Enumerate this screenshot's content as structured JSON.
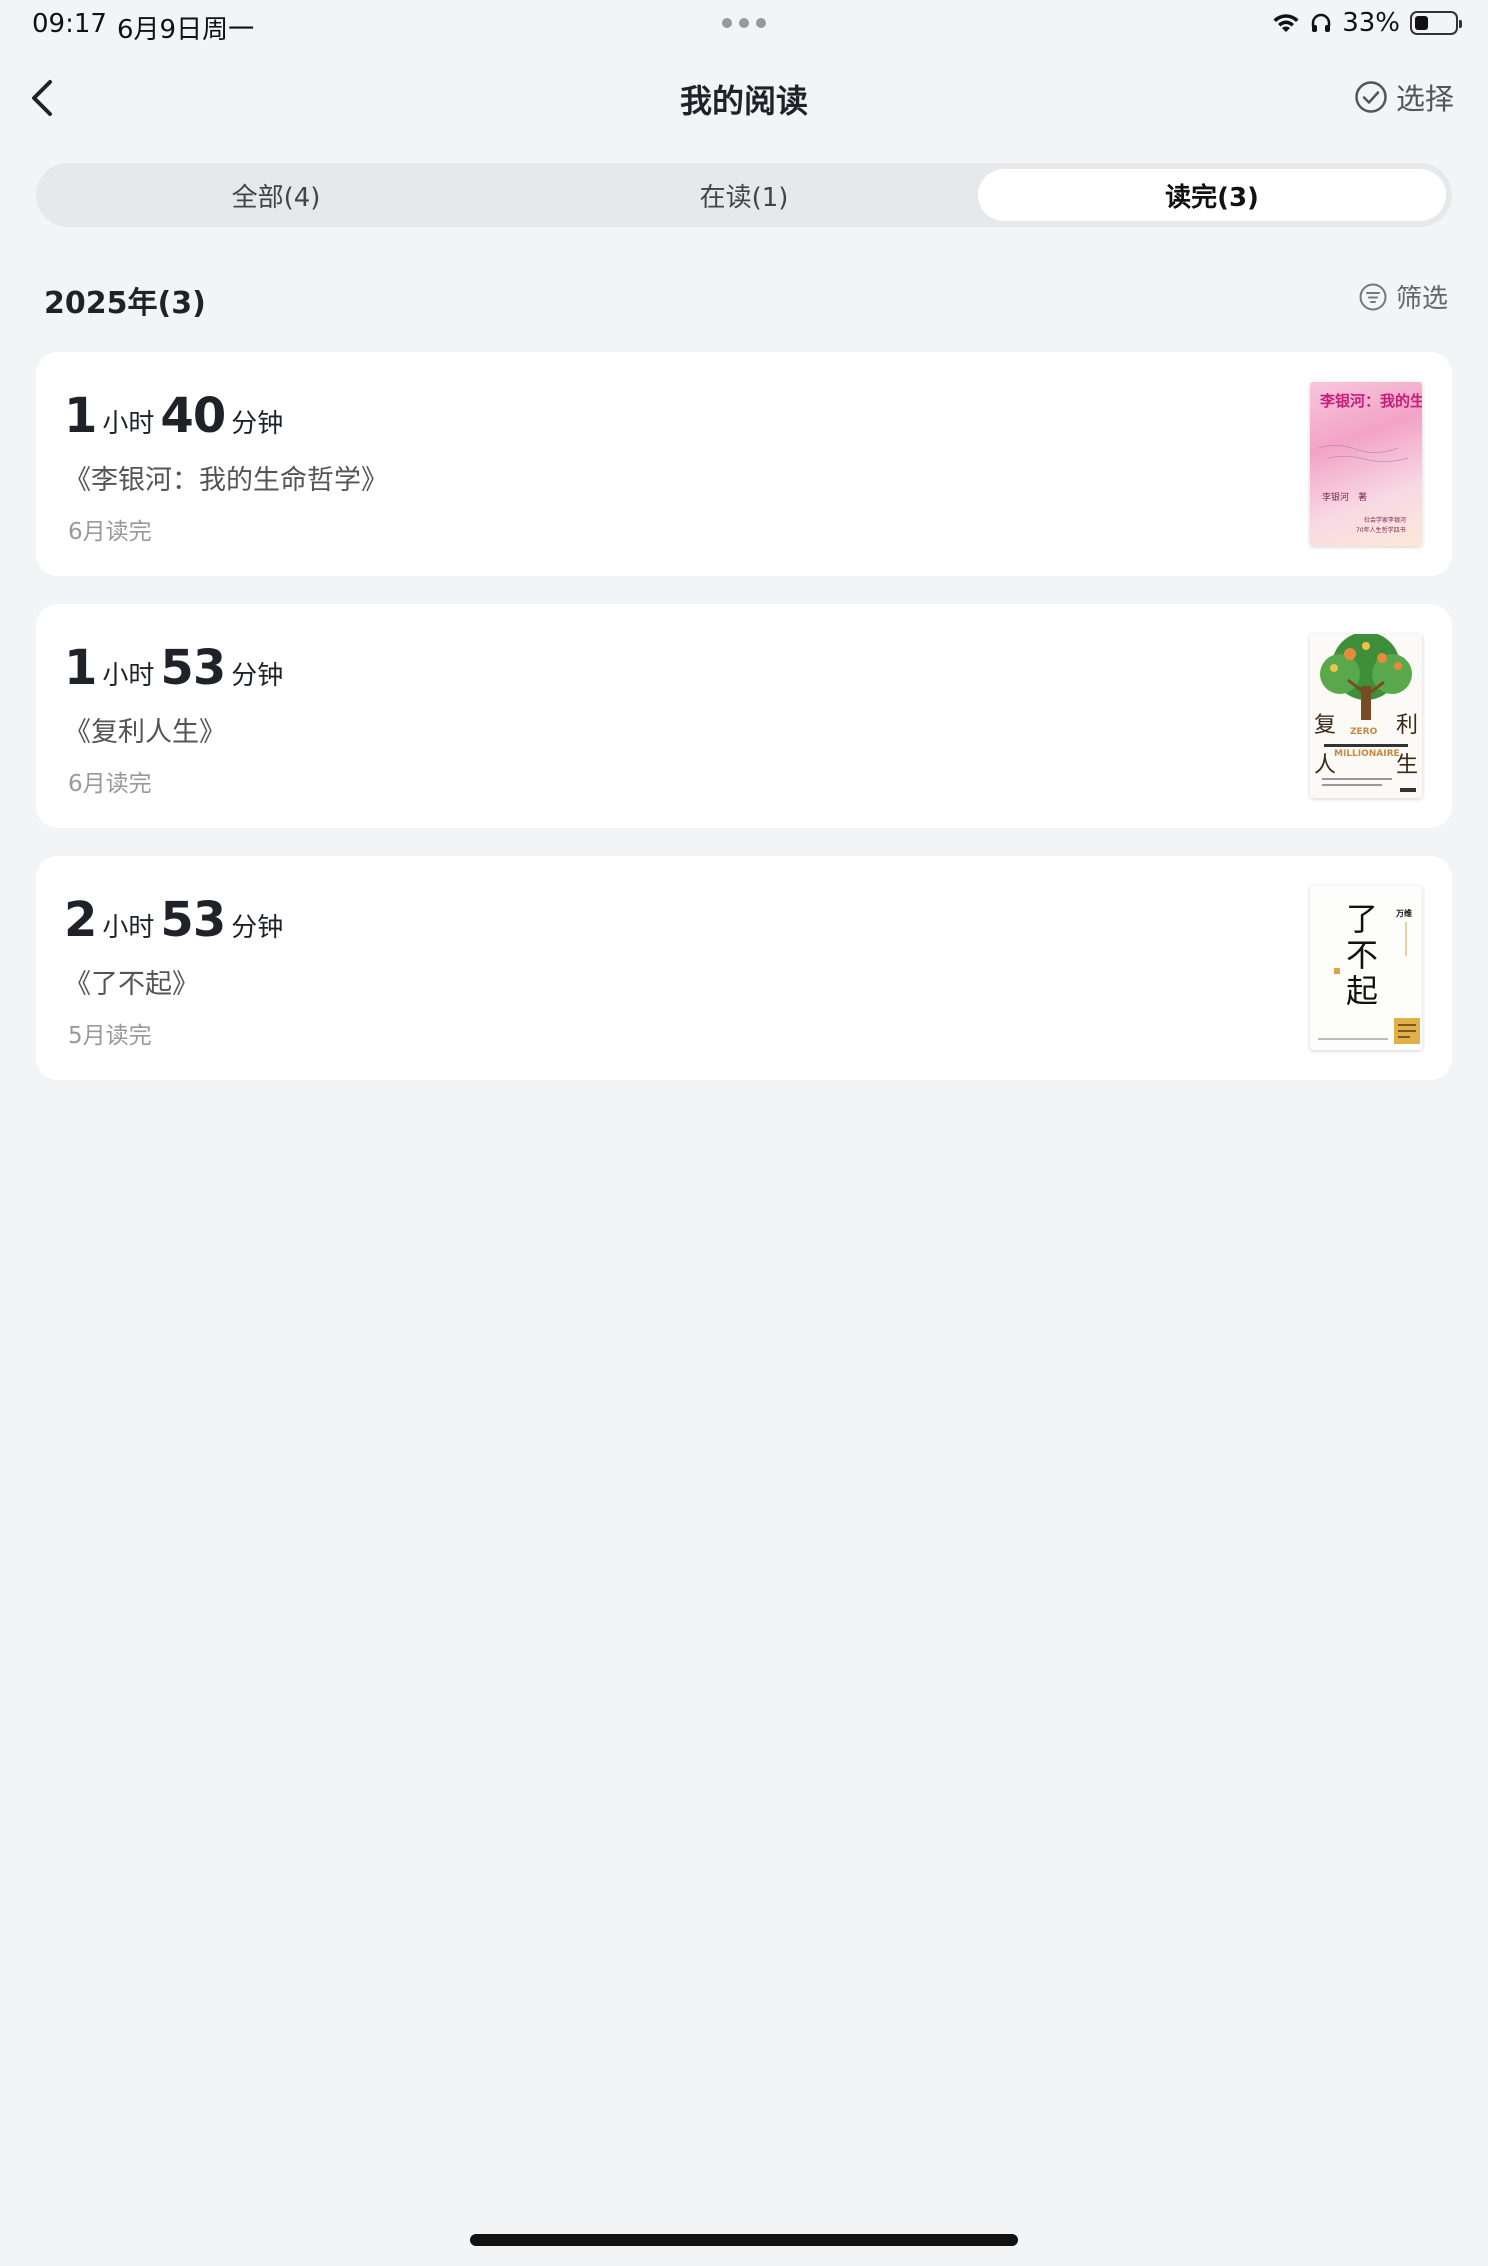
{
  "status": {
    "time": "09:17",
    "date": "6月9日周一",
    "battery_text": "33%",
    "battery_level": 0.33
  },
  "nav": {
    "title": "我的阅读",
    "select_label": "选择"
  },
  "tabs": [
    {
      "label": "全部(4)",
      "active": false
    },
    {
      "label": "在读(1)",
      "active": false
    },
    {
      "label": "读完(3)",
      "active": true
    }
  ],
  "section": {
    "title": "2025年(3)",
    "filter_label": "筛选"
  },
  "books": [
    {
      "hours": "1",
      "hour_unit": "小时",
      "minutes": "40",
      "minute_unit": "分钟",
      "title": "《李银河：我的生命哲学》",
      "finished": "6月读完",
      "cover_text": "李银河：我的生命哲学",
      "cover_author": "李银河　著",
      "cover_tagline_1": "社会学家李银河",
      "cover_tagline_2": "70年人生哲学四书"
    },
    {
      "hours": "1",
      "hour_unit": "小时",
      "minutes": "53",
      "minute_unit": "分钟",
      "title": "《复利人生》",
      "finished": "6月读完",
      "cover_char_1": "复",
      "cover_char_2": "利",
      "cover_char_3": "人",
      "cover_char_4": "生",
      "cover_en_1": "ZERO",
      "cover_en_2": "MILLIONAIRE"
    },
    {
      "hours": "2",
      "hour_unit": "小时",
      "minutes": "53",
      "minute_unit": "分钟",
      "title": "《了不起》",
      "finished": "5月读完",
      "cover_char_1": "了",
      "cover_char_2": "不",
      "cover_char_3": "起",
      "cover_author": "万维"
    }
  ],
  "colors": {
    "background": "#f3f4f6",
    "card": "#ffffff",
    "active_tab": "#ffffff",
    "tab_track": "#e7e8eb"
  }
}
